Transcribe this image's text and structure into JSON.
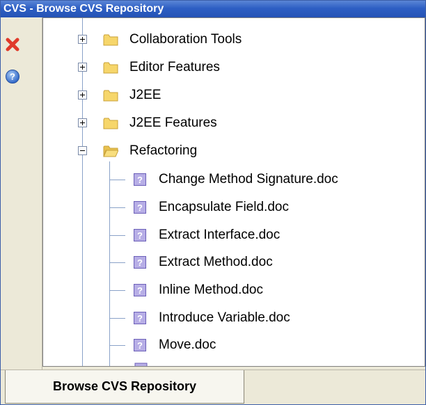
{
  "window": {
    "title": "CVS - Browse CVS Repository"
  },
  "toolbar": {
    "close_icon": "close-icon",
    "help_icon": "help-icon",
    "close_color": "#e03a2a",
    "help_color": "#3a78d6"
  },
  "tree": {
    "folders": [
      {
        "label": "Collaboration Tools",
        "expanded": false
      },
      {
        "label": "Editor Features",
        "expanded": false
      },
      {
        "label": "J2EE",
        "expanded": false
      },
      {
        "label": "J2EE Features",
        "expanded": false
      },
      {
        "label": "Refactoring",
        "expanded": true
      }
    ],
    "files": [
      {
        "label": "Change Method Signature.doc"
      },
      {
        "label": "Encapsulate Field.doc"
      },
      {
        "label": "Extract Interface.doc"
      },
      {
        "label": "Extract Method.doc"
      },
      {
        "label": "Inline Method.doc"
      },
      {
        "label": "Introduce Variable.doc"
      },
      {
        "label": "Move.doc"
      }
    ]
  },
  "tabs": {
    "active_label": "Browse CVS Repository"
  },
  "colors": {
    "titlebar": "#2e5fc4",
    "folder": "#f6d66b",
    "doc_icon": "#9c8fd8"
  }
}
